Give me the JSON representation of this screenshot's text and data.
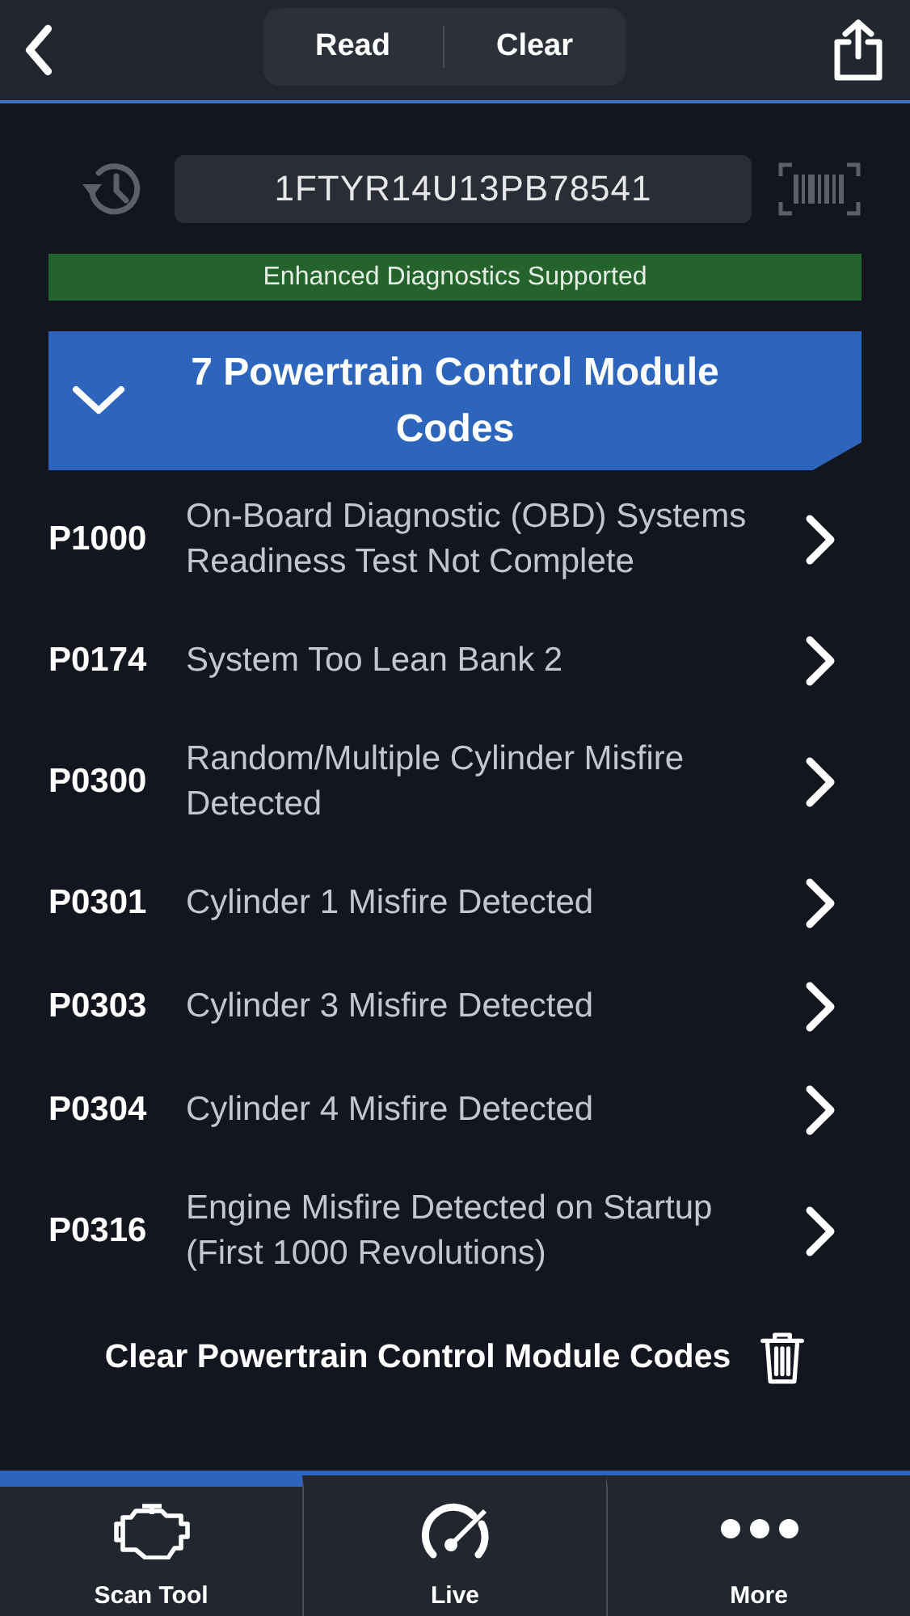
{
  "header": {
    "segments": [
      {
        "label": "Read"
      },
      {
        "label": "Clear"
      }
    ]
  },
  "vin": {
    "value": "1FTYR14U13PB78541"
  },
  "banner": "Enhanced Diagnostics Supported",
  "section": {
    "title": "7 Powertrain Control Module Codes",
    "expanded": true,
    "codes": [
      {
        "code": "P1000",
        "description": "On-Board Diagnostic (OBD) Systems Readiness Test Not Complete"
      },
      {
        "code": "P0174",
        "description": "System Too Lean Bank 2"
      },
      {
        "code": "P0300",
        "description": "Random/Multiple Cylinder Misfire Detected"
      },
      {
        "code": "P0301",
        "description": "Cylinder 1 Misfire Detected"
      },
      {
        "code": "P0303",
        "description": "Cylinder 3 Misfire Detected"
      },
      {
        "code": "P0304",
        "description": "Cylinder 4 Misfire Detected"
      },
      {
        "code": "P0316",
        "description": "Engine Misfire Detected on Startup (First 1000 Revolutions)"
      }
    ],
    "clear_action": "Clear Powertrain Control Module Codes"
  },
  "tabs": [
    {
      "kind": "engine",
      "label": "Scan Tool",
      "selected": true
    },
    {
      "kind": "gauge",
      "label": "Live",
      "selected": false
    },
    {
      "kind": "more",
      "label": "More",
      "selected": false
    }
  ]
}
